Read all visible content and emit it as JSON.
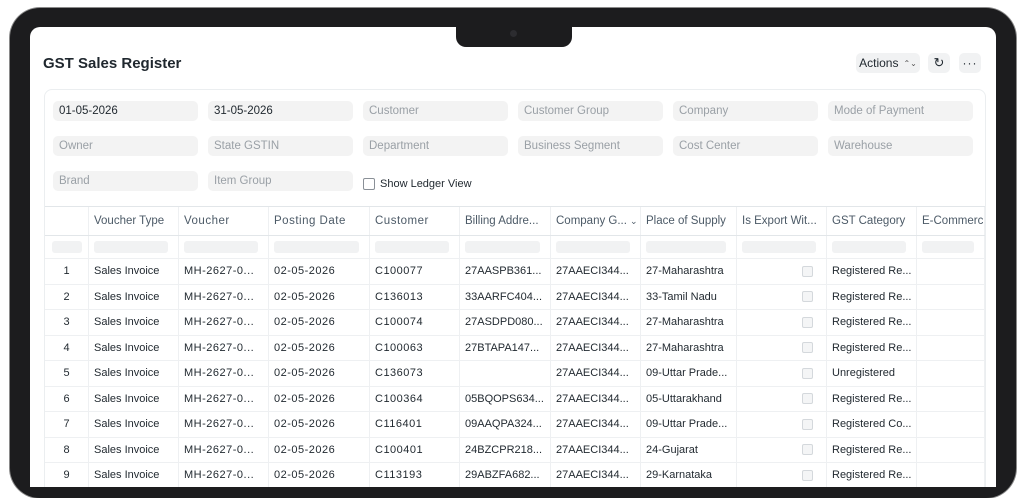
{
  "page": {
    "title": "GST Sales Register"
  },
  "header": {
    "actions_label": "Actions",
    "actions_chevron": "⌃⌄",
    "refresh_icon": "↻",
    "more_icon": "···"
  },
  "filters": [
    {
      "key": "from-date",
      "value": "01-05-2026",
      "filled": true
    },
    {
      "key": "to-date",
      "value": "31-05-2026",
      "filled": true
    },
    {
      "key": "customer",
      "value": "Customer",
      "filled": false
    },
    {
      "key": "customer-group",
      "value": "Customer Group",
      "filled": false
    },
    {
      "key": "company",
      "value": "Company",
      "filled": false
    },
    {
      "key": "mode-of-payment",
      "value": "Mode of Payment",
      "filled": false
    },
    {
      "key": "owner",
      "value": "Owner",
      "filled": false
    },
    {
      "key": "state-gstin",
      "value": "State GSTIN",
      "filled": false
    },
    {
      "key": "department",
      "value": "Department",
      "filled": false
    },
    {
      "key": "business-segment",
      "value": "Business Segment",
      "filled": false
    },
    {
      "key": "cost-center",
      "value": "Cost Center",
      "filled": false
    },
    {
      "key": "warehouse",
      "value": "Warehouse",
      "filled": false
    },
    {
      "key": "brand",
      "value": "Brand",
      "filled": false
    },
    {
      "key": "item-group",
      "value": "Item Group",
      "filled": false
    }
  ],
  "ledger_view": {
    "label": "Show Ledger View"
  },
  "table": {
    "columns": [
      "Voucher Type",
      "Voucher",
      "Posting Date",
      "Customer",
      "Billing Addre...",
      "Company G...",
      "Place of Supply",
      "Is Export Wit...",
      "GST Category",
      "E-Commerc"
    ],
    "rows": [
      {
        "idx": "1",
        "voucher_type": "Sales Invoice",
        "voucher": "MH-2627-0...",
        "posting_date": "02-05-2026",
        "customer": "C100077",
        "billing": "27AASPB361...",
        "company_gstin": "27AAECI344...",
        "place": "27-Maharashtra",
        "gst_category": "Registered Re..."
      },
      {
        "idx": "2",
        "voucher_type": "Sales Invoice",
        "voucher": "MH-2627-0...",
        "posting_date": "02-05-2026",
        "customer": "C136013",
        "billing": "33AARFC404...",
        "company_gstin": "27AAECI344...",
        "place": "33-Tamil Nadu",
        "gst_category": "Registered Re..."
      },
      {
        "idx": "3",
        "voucher_type": "Sales Invoice",
        "voucher": "MH-2627-0...",
        "posting_date": "02-05-2026",
        "customer": "C100074",
        "billing": "27ASDPD080...",
        "company_gstin": "27AAECI344...",
        "place": "27-Maharashtra",
        "gst_category": "Registered Re..."
      },
      {
        "idx": "4",
        "voucher_type": "Sales Invoice",
        "voucher": "MH-2627-0...",
        "posting_date": "02-05-2026",
        "customer": "C100063",
        "billing": "27BTAPA147...",
        "company_gstin": "27AAECI344...",
        "place": "27-Maharashtra",
        "gst_category": "Registered Re..."
      },
      {
        "idx": "5",
        "voucher_type": "Sales Invoice",
        "voucher": "MH-2627-0...",
        "posting_date": "02-05-2026",
        "customer": "C136073",
        "billing": "",
        "company_gstin": "27AAECI344...",
        "place": "09-Uttar Prade...",
        "gst_category": "Unregistered"
      },
      {
        "idx": "6",
        "voucher_type": "Sales Invoice",
        "voucher": "MH-2627-0...",
        "posting_date": "02-05-2026",
        "customer": "C100364",
        "billing": "05BQOPS634...",
        "company_gstin": "27AAECI344...",
        "place": "05-Uttarakhand",
        "gst_category": "Registered Re..."
      },
      {
        "idx": "7",
        "voucher_type": "Sales Invoice",
        "voucher": "MH-2627-0...",
        "posting_date": "02-05-2026",
        "customer": "C116401",
        "billing": "09AAQPA324...",
        "company_gstin": "27AAECI344...",
        "place": "09-Uttar Prade...",
        "gst_category": "Registered Co..."
      },
      {
        "idx": "8",
        "voucher_type": "Sales Invoice",
        "voucher": "MH-2627-0...",
        "posting_date": "02-05-2026",
        "customer": "C100401",
        "billing": "24BZCPR218...",
        "company_gstin": "27AAECI344...",
        "place": "24-Gujarat",
        "gst_category": "Registered Re..."
      },
      {
        "idx": "9",
        "voucher_type": "Sales Invoice",
        "voucher": "MH-2627-0...",
        "posting_date": "02-05-2026",
        "customer": "C113193",
        "billing": "29ABZFA682...",
        "company_gstin": "27AAECI344...",
        "place": "29-Karnataka",
        "gst_category": "Registered Re..."
      }
    ]
  }
}
